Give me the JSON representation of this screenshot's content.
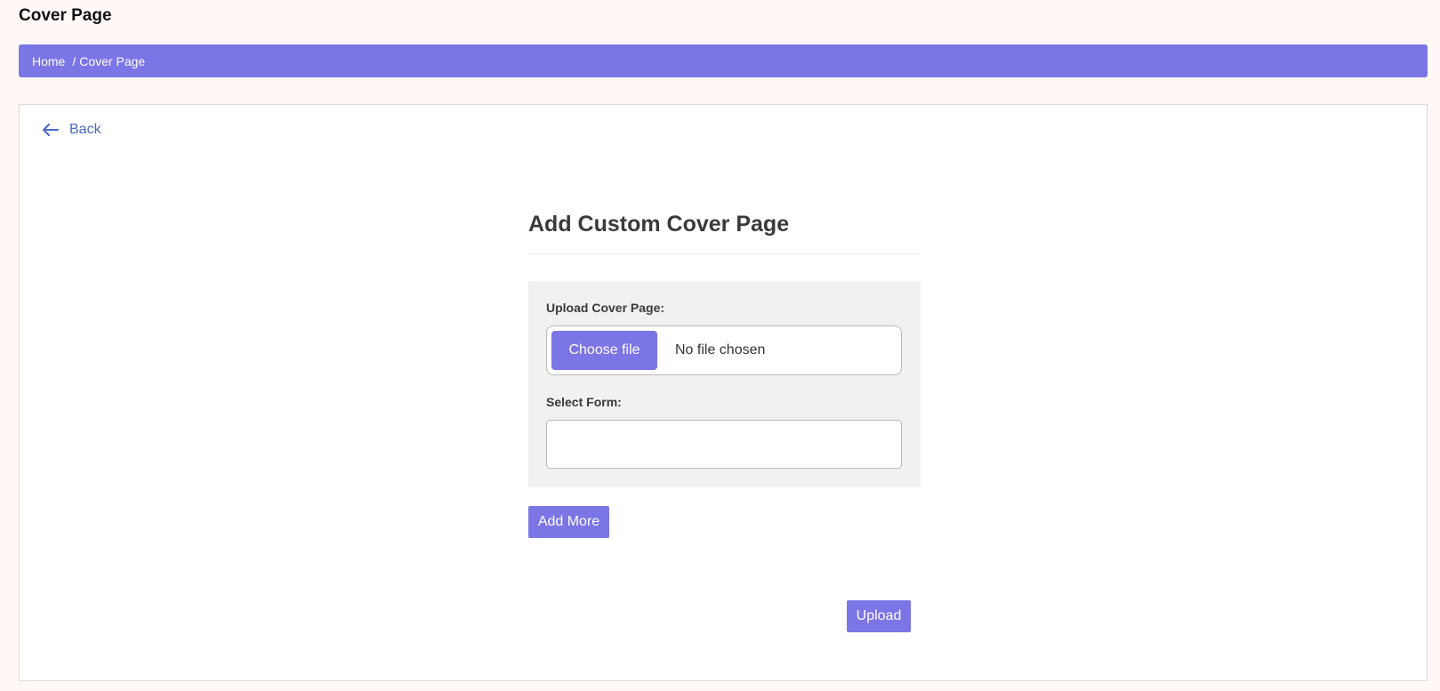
{
  "page": {
    "title": "Cover Page"
  },
  "breadcrumb": {
    "home": "Home",
    "separator": "/",
    "current": "Cover Page"
  },
  "back": {
    "label": "Back",
    "icon": "arrow-left-icon"
  },
  "form": {
    "heading": "Add Custom Cover Page",
    "upload_label": "Upload Cover Page:",
    "choose_file_label": "Choose file",
    "file_status": "No file chosen",
    "select_label": "Select Form:",
    "select_value": "",
    "add_more_label": "Add More",
    "upload_label_button": "Upload"
  },
  "colors": {
    "accent": "#7b75e6",
    "link": "#4a67c9",
    "background": "#fff8f6"
  }
}
